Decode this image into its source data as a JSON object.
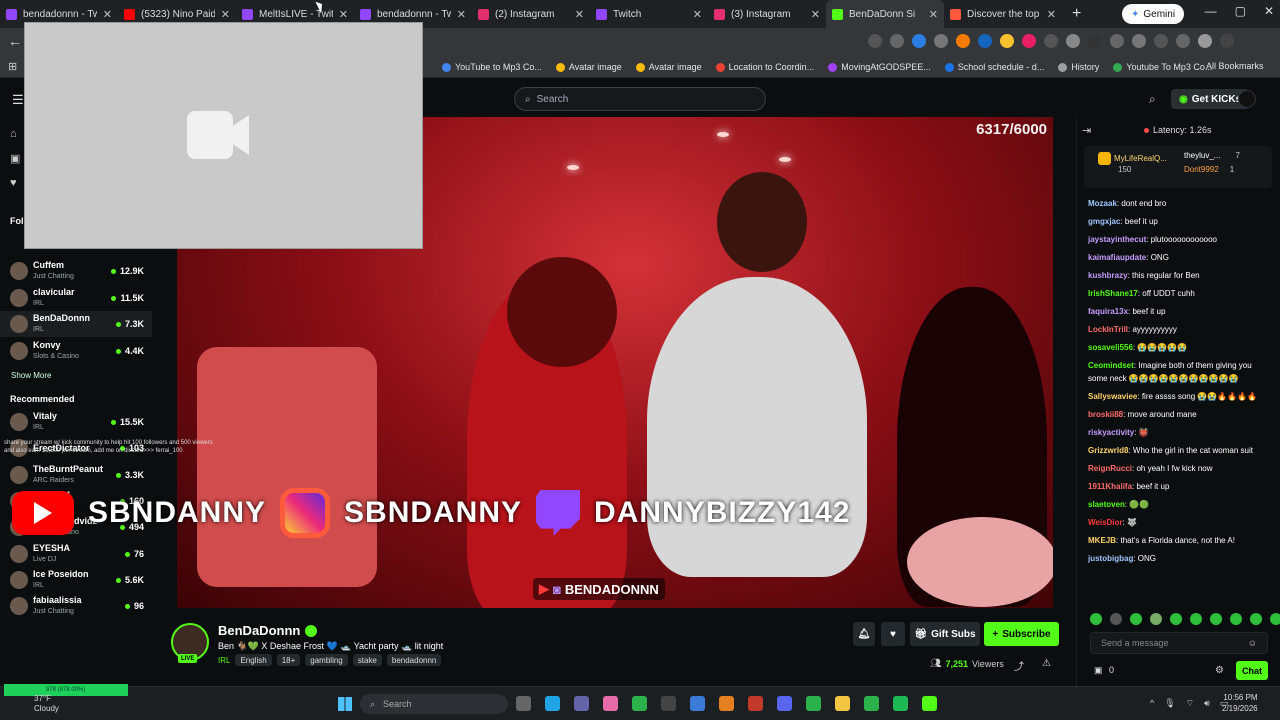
{
  "browser": {
    "tabs": [
      {
        "label": "bendadonnn - Twi",
        "color": "#9146ff"
      },
      {
        "label": "(5323) Nino Paid x ",
        "color": "#ff0000"
      },
      {
        "label": "MeltIsLIVE - Twitch",
        "color": "#9146ff"
      },
      {
        "label": "bendadonnn - Twi",
        "color": "#9146ff"
      },
      {
        "label": "(2) Instagram",
        "color": "#e1306c"
      },
      {
        "label": "Twitch",
        "color": "#9146ff"
      },
      {
        "label": "(3) Instagram",
        "color": "#e1306c"
      },
      {
        "label": "BenDaDonn Si",
        "color": "#53fc18"
      },
      {
        "label": "Discover the top st",
        "color": "#ff5a3c"
      }
    ],
    "new_tab": "+",
    "gemini": "Gemini",
    "bookmarks": [
      "YouTube to Mp3 Co...",
      "Avatar image",
      "Avatar image",
      "Location to Coordin...",
      "MovingAtGODSPEE...",
      "School schedule - d...",
      "History",
      "Youtube To Mp3 Co..."
    ],
    "all_bookmarks": "All Bookmarks"
  },
  "header": {
    "search_placeholder": "Search",
    "get_kicks": "Get KICKs"
  },
  "sidebar": {
    "following_label": "Fol",
    "following": [
      {
        "name": "Cuffem",
        "category": "Just Chatting",
        "viewers": "12.9K"
      },
      {
        "name": "clavicular",
        "category": "IRL",
        "viewers": "11.5K"
      },
      {
        "name": "BenDaDonnn",
        "category": "IRL",
        "viewers": "7.3K"
      },
      {
        "name": "Konvy",
        "category": "Slots & Casino",
        "viewers": "4.4K"
      }
    ],
    "show_more": "Show More",
    "recommended_label": "Recommended",
    "recommended": [
      {
        "name": "Vitaly",
        "category": "IRL",
        "viewers": "15.5K"
      },
      {
        "name": "ErectDictator",
        "category": "",
        "viewers": "103"
      },
      {
        "name": "TheBurntPeanut",
        "category": "ARC Raiders",
        "viewers": "3.3K"
      },
      {
        "name": "ChrisAM",
        "category": "Minecraft",
        "viewers": "160"
      },
      {
        "name": "funnyhoodvidz",
        "category": "Slots & Casino",
        "viewers": "494"
      },
      {
        "name": "EYESHA",
        "category": "Live DJ",
        "viewers": "76"
      },
      {
        "name": "Ice Poseidon",
        "category": "IRL",
        "viewers": "5.6K"
      },
      {
        "name": "fabiaalissia",
        "category": "Just Chatting",
        "viewers": "96"
      }
    ],
    "promo_text": "share your stream w/ kick community to help hit 100 followers and 500 viewers and also earn $1,500 per stream, add me on discord>>> ferrai_100"
  },
  "video": {
    "goal": "6317/6000",
    "banner_1": "SBNDANNY",
    "banner_2": "SBNDANNY",
    "banner_3": "DANNYBIZZY142",
    "tagline": "BENDADONNN"
  },
  "stream": {
    "live_badge": "LIVE",
    "streamer": "BenDaDonnn",
    "title": "Ben 🐐💚 X Deshae Frost 💙 🛥️ Yacht party 🛥️ lit night",
    "category": "IRL",
    "tags": [
      "English",
      "18+",
      "gambling",
      "stake",
      "bendadonnn"
    ],
    "gift_subs": "Gift Subs",
    "subscribe": "Subscribe",
    "viewers": "7,251",
    "viewers_label": "Viewers"
  },
  "chat": {
    "latency": "Latency: 1.26s",
    "pinned": [
      {
        "name": "MyLifeRealQ...",
        "count": "150"
      },
      {
        "name": "theyluv_...",
        "count": "7"
      },
      {
        "name": "Dont9992",
        "count": "1"
      }
    ],
    "messages": [
      {
        "user": "Mozaak",
        "color": "#9ec7ff",
        "text": "dont end bro"
      },
      {
        "user": "gmgxjac",
        "color": "#9ec7ff",
        "text": "beef it up"
      },
      {
        "user": "jaystayinthecut",
        "color": "#c89cff",
        "text": "plutoooooooooooo"
      },
      {
        "user": "kaimafiaupdate",
        "color": "#c89cff",
        "text": "ONG"
      },
      {
        "user": "kushbrazy",
        "color": "#c89cff",
        "text": "this regular for Ben"
      },
      {
        "user": "IrishShane17",
        "color": "#53fc18",
        "text": "off UDDT cuhh"
      },
      {
        "user": "faquira13x",
        "color": "#c89cff",
        "text": "beef it up"
      },
      {
        "user": "LockInTrill",
        "color": "#ff6b6b",
        "text": "ayyyyyyyyyy"
      },
      {
        "user": "sosaveli556",
        "color": "#53fc18",
        "text": "😭😭😭😭😭"
      },
      {
        "user": "Ceomindset",
        "color": "#53fc18",
        "text": "Imagine both of them giving you some neck 😭😭😭😭😭😭😭😭😭😭😭"
      },
      {
        "user": "Sallyswaviee",
        "color": "#ffd36b",
        "text": "fire assss song 😭😭🔥🔥🔥🔥"
      },
      {
        "user": "broskii88",
        "color": "#ff6b6b",
        "text": "move around mane"
      },
      {
        "user": "riskyactivity",
        "color": "#c89cff",
        "text": "👹"
      },
      {
        "user": "Grizzwrld8",
        "color": "#ffd36b",
        "text": "Who the girl in the cat woman suit"
      },
      {
        "user": "ReignRucci",
        "color": "#ff6b6b",
        "text": "oh yeah I fw kick now"
      },
      {
        "user": "1911Khalifa",
        "color": "#ff6b6b",
        "text": "beef it up"
      },
      {
        "user": "slaetoven",
        "color": "#53fc18",
        "text": "🟢🟢"
      },
      {
        "user": "WeisDior",
        "color": "#ff3b3b",
        "text": "🐺"
      },
      {
        "user": "MKEJB",
        "color": "#ffd36b",
        "text": "that's a Florida dance, not the A!"
      },
      {
        "user": "justobigbag",
        "color": "#9ec7ff",
        "text": "ONG"
      }
    ],
    "send_placeholder": "Send a message",
    "kick_count": "0",
    "chat_button": "Chat"
  },
  "taskbar": {
    "weather_temp": "37°F",
    "weather_desc": "Cloudy",
    "search": "Search",
    "time": "10:56 PM",
    "date": "2/19/2026",
    "green_bar_text": "978 (978.00%)"
  }
}
